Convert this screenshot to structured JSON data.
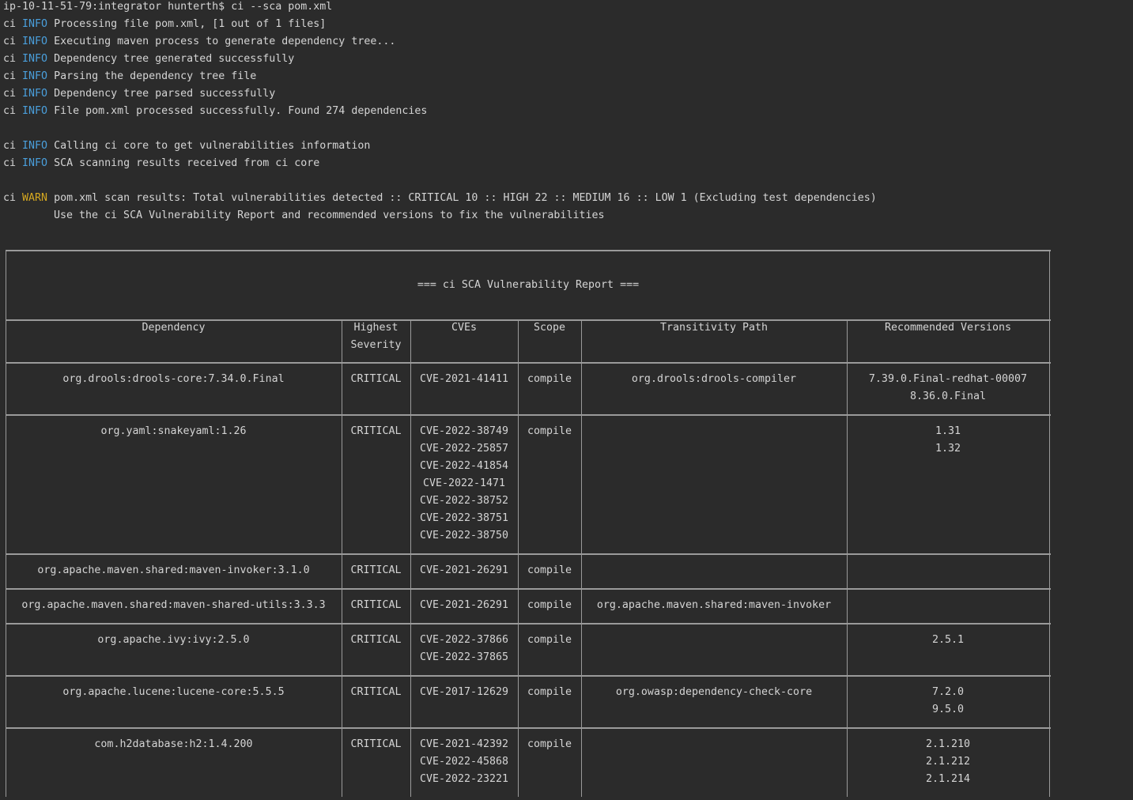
{
  "terminal": {
    "prompt_line": "ip-10-11-51-79:integrator hunterth$ ci --sca pom.xml",
    "log": [
      {
        "prefix": "ci",
        "level": "INFO",
        "message": "Processing file pom.xml, [1 out of 1 files]"
      },
      {
        "prefix": "ci",
        "level": "INFO",
        "message": "Executing maven process to generate dependency tree..."
      },
      {
        "prefix": "ci",
        "level": "INFO",
        "message": "Dependency tree generated successfully"
      },
      {
        "prefix": "ci",
        "level": "INFO",
        "message": "Parsing the dependency tree file"
      },
      {
        "prefix": "ci",
        "level": "INFO",
        "message": "Dependency tree parsed successfully"
      },
      {
        "prefix": "ci",
        "level": "INFO",
        "message": "File pom.xml processed successfully. Found 274 dependencies"
      },
      {
        "prefix": "ci",
        "level": "INFO",
        "message": "Calling ci core to get vulnerabilities information"
      },
      {
        "prefix": "ci",
        "level": "INFO",
        "message": "SCA scanning results received from ci core"
      },
      {
        "prefix": "ci",
        "level": "WARN",
        "message": "pom.xml scan results: Total vulnerabilities detected :: CRITICAL 10 :: HIGH 22 :: MEDIUM 16 :: LOW 1 (Excluding test dependencies)"
      }
    ],
    "warn_continuation": "Use the ci SCA Vulnerability Report and recommended versions to fix the vulnerabilities"
  },
  "colors": {
    "background": "#2b2b2b",
    "text": "#d4d4d4",
    "info": "#4a9fdc",
    "warn": "#d6a820",
    "border": "#9a9a9a"
  },
  "report": {
    "title": "=== ci SCA Vulnerability Report ===",
    "headers": {
      "dependency": "Dependency",
      "severity_1": "Highest",
      "severity_2": "Severity",
      "cves": "CVEs",
      "scope": "Scope",
      "path": "Transitivity Path",
      "recommended": "Recommended Versions"
    },
    "rows": [
      {
        "dependency": "org.drools:drools-core:7.34.0.Final",
        "severity": "CRITICAL",
        "cves": [
          "CVE-2021-41411"
        ],
        "scope": "compile",
        "path": "org.drools:drools-compiler",
        "recommended": [
          "7.39.0.Final-redhat-00007",
          "8.36.0.Final"
        ]
      },
      {
        "dependency": "org.yaml:snakeyaml:1.26",
        "severity": "CRITICAL",
        "cves": [
          "CVE-2022-38749",
          "CVE-2022-25857",
          "CVE-2022-41854",
          "CVE-2022-1471",
          "CVE-2022-38752",
          "CVE-2022-38751",
          "CVE-2022-38750"
        ],
        "scope": "compile",
        "path": "",
        "recommended": [
          "1.31",
          "1.32"
        ]
      },
      {
        "dependency": "org.apache.maven.shared:maven-invoker:3.1.0",
        "severity": "CRITICAL",
        "cves": [
          "CVE-2021-26291"
        ],
        "scope": "compile",
        "path": "",
        "recommended": []
      },
      {
        "dependency": "org.apache.maven.shared:maven-shared-utils:3.3.3",
        "severity": "CRITICAL",
        "cves": [
          "CVE-2021-26291"
        ],
        "scope": "compile",
        "path": "org.apache.maven.shared:maven-invoker",
        "recommended": []
      },
      {
        "dependency": "org.apache.ivy:ivy:2.5.0",
        "severity": "CRITICAL",
        "cves": [
          "CVE-2022-37866",
          "CVE-2022-37865"
        ],
        "scope": "compile",
        "path": "",
        "recommended": [
          "2.5.1"
        ]
      },
      {
        "dependency": "org.apache.lucene:lucene-core:5.5.5",
        "severity": "CRITICAL",
        "cves": [
          "CVE-2017-12629"
        ],
        "scope": "compile",
        "path": "org.owasp:dependency-check-core",
        "recommended": [
          "7.2.0",
          "9.5.0"
        ]
      },
      {
        "dependency": "com.h2database:h2:1.4.200",
        "severity": "CRITICAL",
        "cves": [
          "CVE-2021-42392",
          "CVE-2022-45868",
          "CVE-2022-23221"
        ],
        "scope": "compile",
        "path": "",
        "recommended": [
          "2.1.210",
          "2.1.212",
          "2.1.214"
        ]
      }
    ]
  }
}
